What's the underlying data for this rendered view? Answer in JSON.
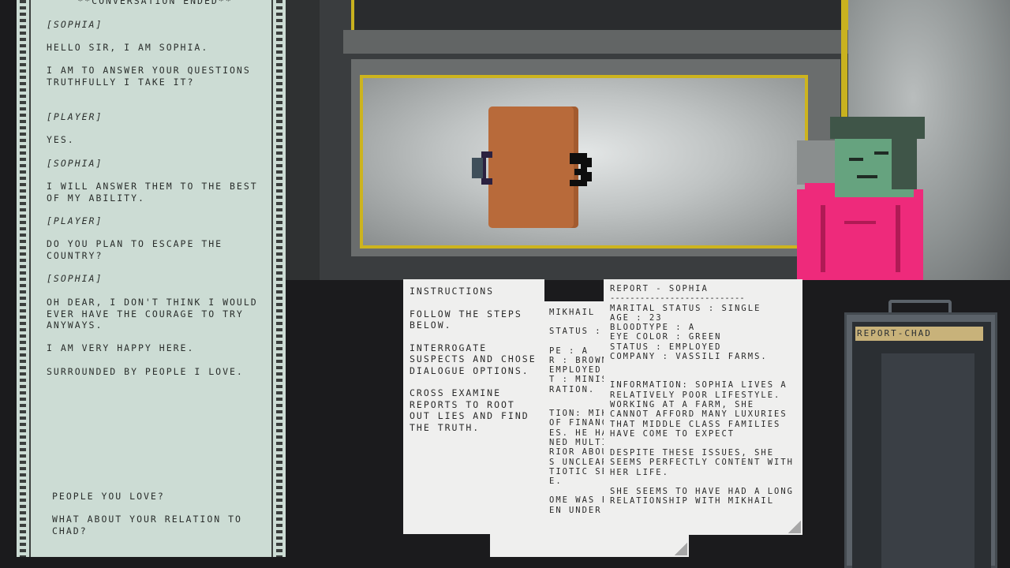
{
  "dialogue": {
    "header": "**CONVERSATION ENDED**",
    "lines": [
      "[SOPHIA]",
      "HELLO SIR, I AM SOPHIA.",
      "I AM TO ANSWER YOUR QUESTIONS TRUTHFULLY I TAKE IT?",
      "[PLAYER]",
      "YES.",
      "[SOPHIA]",
      "I WILL ANSWER THEM TO THE BEST OF MY ABILITY.",
      "[PLAYER]",
      "DO YOU PLAN TO ESCAPE THE COUNTRY?",
      "[SOPHIA]",
      "OH DEAR, I DON'T THINK I WOULD EVER HAVE THE COURAGE TO TRY ANYWAYS.",
      "I AM VERY HAPPY HERE.",
      "SURROUNDED BY PEOPLE I LOVE."
    ],
    "choices": [
      "PEOPLE YOU LOVE?",
      "WHAT ABOUT YOUR RELATION TO CHAD?"
    ]
  },
  "instructions": {
    "title": "INSTRUCTIONS",
    "p1": "FOLLOW THE STEPS BELOW.",
    "p2": "INTERROGATE SUSPECTS AND CHOSE DIALOGUE OPTIONS.",
    "p3": "CROSS EXAMINE REPORTS TO ROOT OUT LIES AND FIND THE TRUTH."
  },
  "report_mikhail": {
    "lines": [
      "MIKHAIL",
      "STATUS : SI",
      "",
      "PE : A",
      "R : BROWN",
      "EMPLOYED",
      "T : MINISTR",
      "RATION.",
      "",
      "TION: MIKHA",
      "OF FINANCI",
      "ES. HE HAS",
      "NED MULTIP",
      "RIOR ABOUT",
      "S UNCLEAR",
      "TIOTIC SENT",
      "E.",
      "",
      "OME WAS FO",
      "EN UNDER"
    ]
  },
  "report_sophia": {
    "title": "REPORT - SOPHIA",
    "rule": "---------------------------",
    "fields": [
      "MARITAL STATUS : SINGLE",
      "AGE : 23",
      "BLOODTYPE : A",
      "EYE COLOR : GREEN",
      "STATUS : EMPLOYED",
      "COMPANY : VASSILI FARMS."
    ],
    "info1": "INFORMATION: SOPHIA LIVES A RELATIVELY POOR LIFESTYLE. WORKING AT A FARM, SHE CANNOT AFFORD MANY LUXURIES THAT MIDDLE CLASS FAMILIES HAVE COME TO EXPECT",
    "info2": "DESPITE THESE ISSUES, SHE SEEMS PERFECTLY CONTENT WITH HER LIFE.",
    "info3": "SHE SEEMS TO HAVE HAD A LONG RELATIONSHIP WITH MIKHAIL"
  },
  "cabinet": {
    "label": "REPORT-CHAD"
  },
  "colors": {
    "yellow_stripe": "#cdb41e",
    "table": "#b86a3a",
    "shirt": "#ee2a7b",
    "skin": "#66a37f",
    "hair": "#3f5548",
    "panel": "#ccdcd4"
  }
}
